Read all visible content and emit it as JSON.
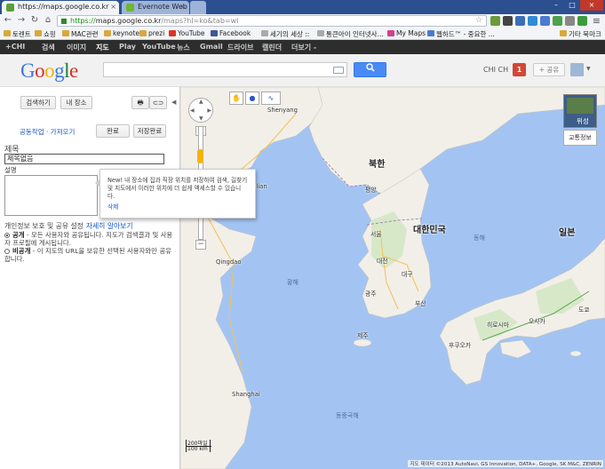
{
  "browser": {
    "tabs": [
      {
        "title": "https://maps.google.co.kr",
        "active": true
      },
      {
        "title": "Evernote Web",
        "active": false
      }
    ],
    "url": {
      "scheme": "https://",
      "host": "maps.google.co.kr",
      "path": "/maps?hl=ko&tab=wl"
    },
    "bookmarks": [
      "토렌트",
      "쇼핑",
      "MAC관련",
      "keynote",
      "prezi",
      "YouTube",
      "Facebook",
      "세기의 세상 ::",
      "통큰아이 인터넷사...",
      "My Maps",
      "웹하드™ - 중요한 ...",
      "기타 북마크"
    ]
  },
  "gbar": {
    "items": [
      "+CHI",
      "검색",
      "이미지",
      "지도",
      "Play",
      "YouTube",
      "뉴스",
      "Gmail",
      "드라이브",
      "캘린더",
      "더보기 -"
    ],
    "active": "지도"
  },
  "header": {
    "logo": "Google",
    "user": "CHI CH",
    "notifications": "1",
    "share_label": "+ 공유"
  },
  "panel": {
    "cancel_label": "검색하기",
    "my_places_label": "내 장소",
    "collab_label": "공동작업 · 가져오기",
    "done_label": "완료",
    "save_label": "저장완료",
    "title_label": "제목",
    "title_value": "제목없음",
    "desc_label": "설명",
    "tooltip_text": "New! 내 장소에 집과 직장 위치를 저장하여 검색, 길찾기 및 지도에서 이러한 위치에 더 쉽게 액세스할 수 있습니다.",
    "tooltip_delete": "삭제",
    "privacy_heading": "개인정보 보호 및 공유 설정",
    "privacy_learn": "자세히 알아보기",
    "public_title": "공개",
    "public_desc": " - 모든 사용자와 공유됩니다. 지도가 검색결과 및 사용자 프로필에 게시됩니다.",
    "unlisted_title": "비공개",
    "unlisted_desc": " - 이 지도의 URL을 보유한 선택된 사용자와만 공유합니다."
  },
  "map": {
    "satellite_label": "위성",
    "traffic_label": "교통정보",
    "scale_top": "200마일",
    "scale_bottom": "100 km",
    "attribution": "지도 데이터 ©2013 AutoNavi, GS Innovation, DATA+, Google, SK M&C, ZENRIN",
    "labels": {
      "north_korea": "북한",
      "south_korea": "대한민국",
      "japan": "일본",
      "shenyang": "Shenyang",
      "dalian": "Dalian",
      "qingdao": "Qingdao",
      "shanghai": "Shanghai",
      "pyongyang": "평양",
      "seoul": "서울",
      "daejeon": "대전",
      "daegu": "대구",
      "busan": "부산",
      "gwangju": "광주",
      "jeju": "제주",
      "tokyo": "도쿄",
      "osaka": "오사카",
      "hiroshima": "히로시마",
      "fukuoka": "후쿠오카",
      "yellow_sea": "황해",
      "east_china_sea": "동중국해",
      "east_sea": "동해"
    }
  },
  "colors": {
    "gbar": "#2d2d2d",
    "search_btn": "#4a8af4",
    "notif": "#d14836",
    "water": "#a3c4f2",
    "land": "#f2efe9"
  }
}
